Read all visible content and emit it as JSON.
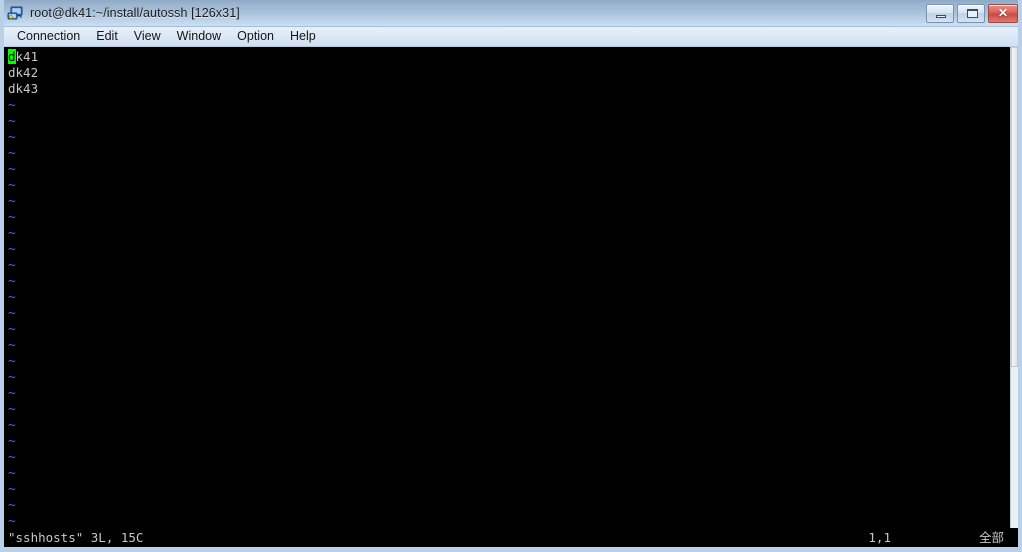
{
  "window": {
    "title": "root@dk41:~/install/autossh [126x31]",
    "icon": "terminal-computer-icon",
    "controls": {
      "minimize_label": "Minimize",
      "maximize_label": "Maximize",
      "close_label": "Close",
      "close_glyph": "✕"
    },
    "accent_titlebar": "#a9c1d9",
    "accent_close": "#c74a40"
  },
  "menubar": {
    "items": [
      {
        "label": "Connection"
      },
      {
        "label": "Edit"
      },
      {
        "label": "View"
      },
      {
        "label": "Window"
      },
      {
        "label": "Option"
      },
      {
        "label": "Help"
      }
    ]
  },
  "terminal": {
    "background": "#000000",
    "foreground": "#c8c8c8",
    "tilde_color": "#5c5cff",
    "cursor_color": "#00ff00",
    "size": "126x31",
    "cursor_char": "d",
    "lines": [
      {
        "text": "k41",
        "type": "text",
        "cursor": true
      },
      {
        "text": "dk42",
        "type": "text",
        "cursor": false
      },
      {
        "text": "dk43",
        "type": "text",
        "cursor": false
      }
    ],
    "tilde": "~",
    "tilde_count": 27
  },
  "statusline": {
    "file_info": "\"sshhosts\" 3L, 15C",
    "position": "1,1",
    "scope": "全部"
  }
}
